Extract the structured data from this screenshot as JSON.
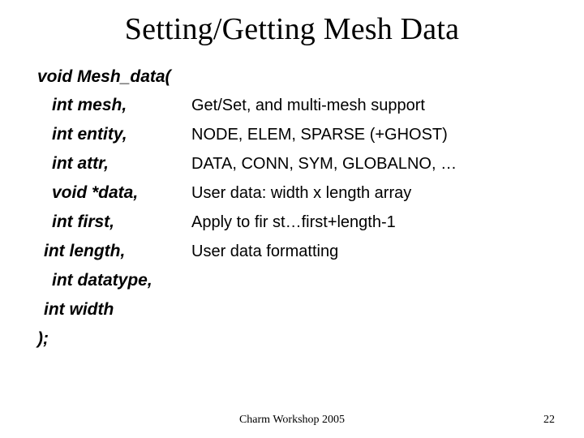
{
  "title": "Setting/Getting Mesh Data",
  "signature": "void Mesh_data(",
  "params": [
    {
      "name": "int mesh,",
      "desc": "Get/Set, and multi-mesh support",
      "indent": true
    },
    {
      "name": "int entity,",
      "desc": "NODE, ELEM, SPARSE (+GHOST)",
      "indent": true
    },
    {
      "name": "int attr,",
      "desc": "DATA, CONN, SYM, GLOBALNO, …",
      "indent": true
    },
    {
      "name": "void *data,",
      "desc": "User data: width x length array",
      "indent": true
    },
    {
      "name": "int first,",
      "desc": "Apply to fir st…first+length-1",
      "indent": true
    },
    {
      "name": "int length,",
      "desc": "User data formatting",
      "indent": false
    },
    {
      "name": "int datatype,",
      "desc": "",
      "indent": true
    },
    {
      "name": "int width",
      "desc": "",
      "indent": false
    }
  ],
  "closing": ");",
  "footer": {
    "center": "Charm Workshop 2005",
    "page": "22"
  }
}
